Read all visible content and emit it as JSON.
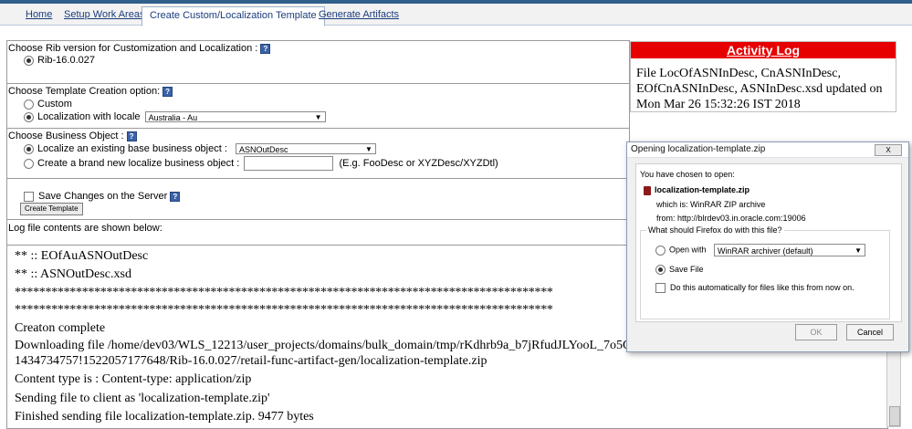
{
  "tabs": [
    {
      "label": "Home"
    },
    {
      "label": "Setup Work Areas"
    },
    {
      "label": "Create Custom/Localization Template"
    },
    {
      "label": "Generate Artifacts"
    }
  ],
  "rib_section": {
    "heading": "Choose Rib version for Customization and Localization :",
    "option": "Rib-16.0.027"
  },
  "template_section": {
    "heading": "Choose Template Creation option:",
    "custom_label": "Custom",
    "locale_label": "Localization with locale",
    "locale_value": "Australia - Au"
  },
  "business_section": {
    "heading": "Choose Business Object :",
    "existing_label": "Localize an existing base business object :",
    "existing_value": "ASNOutDesc",
    "new_label": "Create a brand new localize business object :",
    "new_hint": "(E.g. FooDesc or XYZDesc/XYZDtl)"
  },
  "save_section": {
    "checkbox_label": "Save Changes on the Server",
    "button_label": "Create Template"
  },
  "log_heading": "Log file contents are shown below:",
  "log_lines": [
    "** :: EOfAuASNOutDesc",
    "** :: ASNOutDesc.xsd",
    "****************************************************************************************",
    "****************************************************************************************",
    "Creaton complete",
    "Downloading file /home/dev03/WLS_12213/user_projects/domains/bulk_domain/tmp/rKdhrb9a_b7jRfudJLYooL_7o5Q",
    "1434734757!1522057177648/Rib-16.0.027/retail-func-artifact-gen/localization-template.zip",
    "Content type is : Content-type: application/zip",
    "Sending file to client as 'localization-template.zip'",
    "Finished sending file localization-template.zip. 9477 bytes"
  ],
  "activity_log": {
    "title": "Activity Log",
    "message": "File LocOfASNInDesc, CnASNInDesc, EOfCnASNInDesc, ASNInDesc.xsd updated on Mon Mar 26 15:32:26 IST 2018"
  },
  "dialog": {
    "title": "Opening localization-template.zip",
    "close_label": "X",
    "chosen_text": "You have chosen to open:",
    "filename": "localization-template.zip",
    "which_is": "which is:  WinRAR ZIP archive",
    "from": "from:  http://blrdev03.in.oracle.com:19006",
    "question": "What should Firefox do with this file?",
    "open_with_label": "Open with",
    "open_with_value": "WinRAR archiver (default)",
    "save_file_label": "Save File",
    "auto_label": "Do this automatically for files like this from now on.",
    "ok_label": "OK",
    "cancel_label": "Cancel"
  },
  "colors": {
    "activity_header": "#e60000",
    "tab_link": "#1a3d7c"
  }
}
